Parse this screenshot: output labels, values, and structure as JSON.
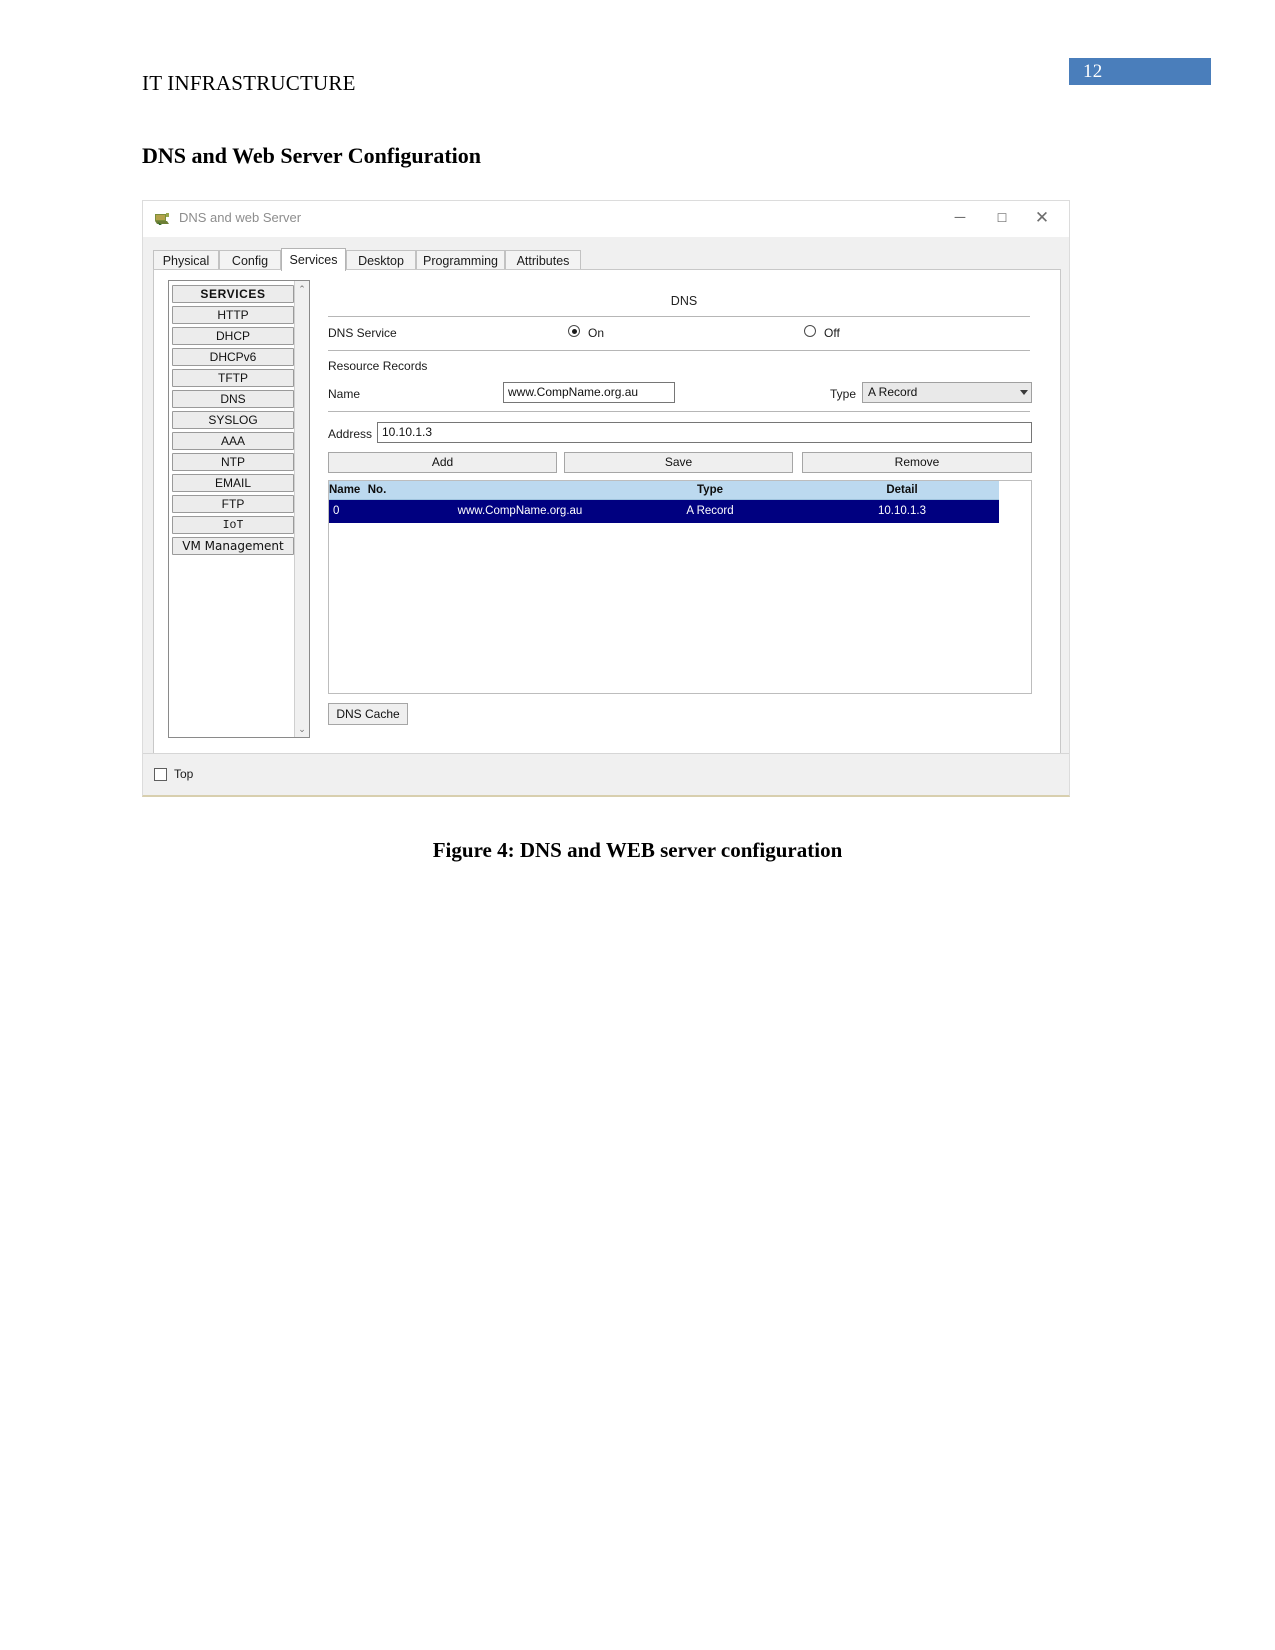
{
  "document": {
    "running_head": "IT INFRASTRUCTURE",
    "page_number": "12",
    "section_heading": "DNS and Web Server Configuration",
    "figure_caption": "Figure 4: DNS and WEB server configuration",
    "page_number_bg": "#4a7ebb"
  },
  "window": {
    "title": "DNS and web Server",
    "icon": "server-device-icon",
    "minimize_label": "─",
    "maximize_label": "☐",
    "close_label": "✕"
  },
  "tabs": [
    {
      "label": "Physical",
      "active": false
    },
    {
      "label": "Config",
      "active": false
    },
    {
      "label": "Services",
      "active": true
    },
    {
      "label": "Desktop",
      "active": false
    },
    {
      "label": "Programming",
      "active": false
    },
    {
      "label": "Attributes",
      "active": false
    }
  ],
  "sidebar": {
    "header": "SERVICES",
    "items": [
      {
        "label": "HTTP"
      },
      {
        "label": "DHCP"
      },
      {
        "label": "DHCPv6"
      },
      {
        "label": "TFTP"
      },
      {
        "label": "DNS"
      },
      {
        "label": "SYSLOG"
      },
      {
        "label": "AAA"
      },
      {
        "label": "NTP"
      },
      {
        "label": "EMAIL"
      },
      {
        "label": "FTP"
      },
      {
        "label": "IoT"
      },
      {
        "label": "VM Management"
      }
    ],
    "scroll_up": "⌃",
    "scroll_down": "⌄"
  },
  "panel": {
    "title": "DNS",
    "service_label": "DNS Service",
    "radio_on_label": "On",
    "radio_off_label": "Off",
    "service_state": "On",
    "resource_records_label": "Resource Records",
    "name_label": "Name",
    "name_value": "www.CompName.org.au",
    "type_label": "Type",
    "type_value": "A Record",
    "address_label": "Address",
    "address_value": "10.10.1.3",
    "buttons": {
      "add": "Add",
      "save": "Save",
      "remove": "Remove",
      "dns_cache": "DNS Cache"
    },
    "table": {
      "columns": [
        "No.",
        "Name",
        "Type",
        "Detail"
      ],
      "rows": [
        {
          "no": "0",
          "name": "www.CompName.org.au",
          "type": "A Record",
          "detail": "10.10.1.3",
          "selected": true
        }
      ],
      "header_bg": "#bcd9ef",
      "selected_row_bg": "#000080"
    }
  },
  "statusbar": {
    "top_checkbox_label": "Top",
    "top_checked": false
  }
}
